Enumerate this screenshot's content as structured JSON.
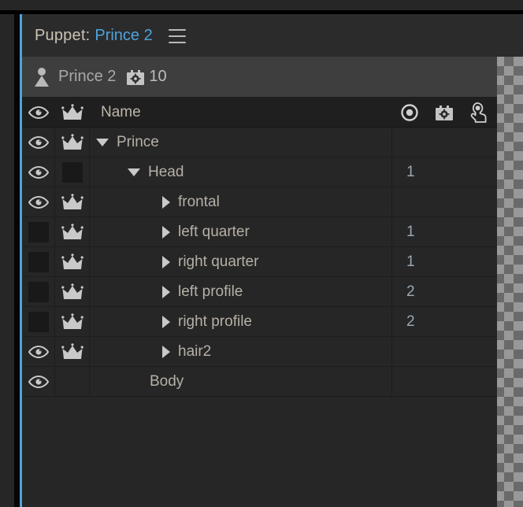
{
  "window": {
    "title_label": "Puppet:",
    "title_value": "Prince 2",
    "menu_icon": "hamburger-menu-icon",
    "accent_color": "#4da3dd"
  },
  "breadcrumb": {
    "puppet_icon": "puppet-person-icon",
    "puppet_name": "Prince 2",
    "behavior_icon": "behavior-gear-box-icon",
    "behavior_count": "10"
  },
  "table": {
    "columns": {
      "visibility_icon": "eye-icon",
      "crown_icon": "crown-icon",
      "name": "Name",
      "origin_icon": "target-origin-icon",
      "behaviors_icon": "behavior-gear-box-icon",
      "triggers_icon": "pointing-hand-icon"
    },
    "rows": [
      {
        "name": "Prince",
        "indent": 0,
        "disclosure": "down",
        "visible": true,
        "crown": "on",
        "value": ""
      },
      {
        "name": "Head",
        "indent": 1,
        "disclosure": "down",
        "visible": true,
        "crown": "off",
        "value": "1"
      },
      {
        "name": "frontal",
        "indent": 2,
        "disclosure": "right",
        "visible": true,
        "crown": "on",
        "value": ""
      },
      {
        "name": "left quarter",
        "indent": 2,
        "disclosure": "right",
        "visible": false,
        "crown": "on",
        "value": "1"
      },
      {
        "name": "right quarter",
        "indent": 2,
        "disclosure": "right",
        "visible": false,
        "crown": "on",
        "value": "1"
      },
      {
        "name": "left profile",
        "indent": 2,
        "disclosure": "right",
        "visible": false,
        "crown": "on",
        "value": "2"
      },
      {
        "name": "right profile",
        "indent": 2,
        "disclosure": "right",
        "visible": false,
        "crown": "on",
        "value": "2"
      },
      {
        "name": "hair2",
        "indent": 2,
        "disclosure": "right",
        "visible": true,
        "crown": "on",
        "value": ""
      },
      {
        "name": "Body",
        "indent": 1,
        "disclosure": "none",
        "visible": true,
        "crown": "none",
        "value": ""
      }
    ]
  }
}
